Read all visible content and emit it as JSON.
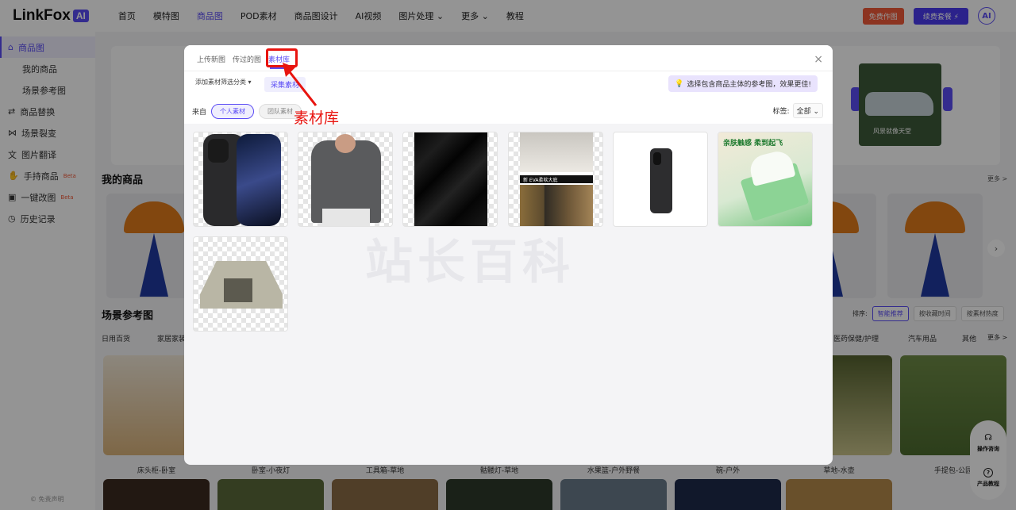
{
  "app": {
    "logo_text": "LinkFox",
    "logo_badge": "AI",
    "nav": [
      "首页",
      "模特图",
      "商品图",
      "POD素材",
      "商品图设计",
      "AI视频",
      "图片处理 ⌄",
      "更多 ⌄",
      "教程"
    ],
    "nav_active": "商品图",
    "free_btn": "免费作图",
    "renew_btn": "续费套餐 ⚡",
    "avatar": "AI"
  },
  "sidebar": {
    "items": [
      {
        "label": "商品图",
        "icon": "⌂"
      },
      {
        "label": "我的商品"
      },
      {
        "label": "场景参考图"
      },
      {
        "label": "商品替换",
        "icon": "⇄"
      },
      {
        "label": "场景裂变",
        "icon": "⋈"
      },
      {
        "label": "图片翻译",
        "icon": "文"
      },
      {
        "label": "手持商品",
        "icon": "✋",
        "badge": "Beta"
      },
      {
        "label": "一键改图",
        "icon": "▣",
        "badge": "Beta"
      },
      {
        "label": "历史记录",
        "icon": "◷"
      }
    ],
    "footer": "© 免责声明"
  },
  "page": {
    "my_products_title": "我的商品",
    "scene_ref_title": "场景参考图",
    "more": "更多 >",
    "sort_label": "排序:",
    "sort_options": [
      "智能推荐",
      "按收藏时间",
      "按素材热度"
    ],
    "categories_left": [
      "日用百货",
      "家居家装"
    ],
    "categories_right": [
      "医药保健/护理",
      "汽车用品",
      "其他",
      "更多 >"
    ],
    "scene_labels": [
      "床头柜-卧室",
      "卧室-小夜灯",
      "工具箱-草地",
      "骷髅灯-草地",
      "水果篮-户外野餐",
      "碗-户外",
      "草地-水壶",
      "手提包-公园"
    ],
    "help": [
      "操作咨询",
      "产品教程"
    ],
    "sample_caption": "风景就像天堂"
  },
  "modal": {
    "tabs": [
      "上传新图",
      "传过的图",
      "素材库"
    ],
    "active_tab": "素材库",
    "filter_add": "添加素材筛选分类 ▾",
    "collect_btn": "采集素材",
    "tip": "选择包含商品主体的参考图，效果更佳!",
    "annotation": "素材库",
    "from_label": "来自",
    "from_options": [
      "个人素材",
      "团队素材"
    ],
    "tag_label": "标签:",
    "tag_value": "全部",
    "close": "×",
    "assets": [
      {
        "name": "iphone-pair"
      },
      {
        "name": "man-tshirt"
      },
      {
        "name": "black-fabric"
      },
      {
        "name": "slipper-poster",
        "text": "新 EVA柔软大底"
      },
      {
        "name": "iphone-black"
      },
      {
        "name": "tissue-box",
        "text": "亲肤触感  柔到起飞"
      },
      {
        "name": "tent"
      }
    ]
  },
  "watermark": "站长百科"
}
